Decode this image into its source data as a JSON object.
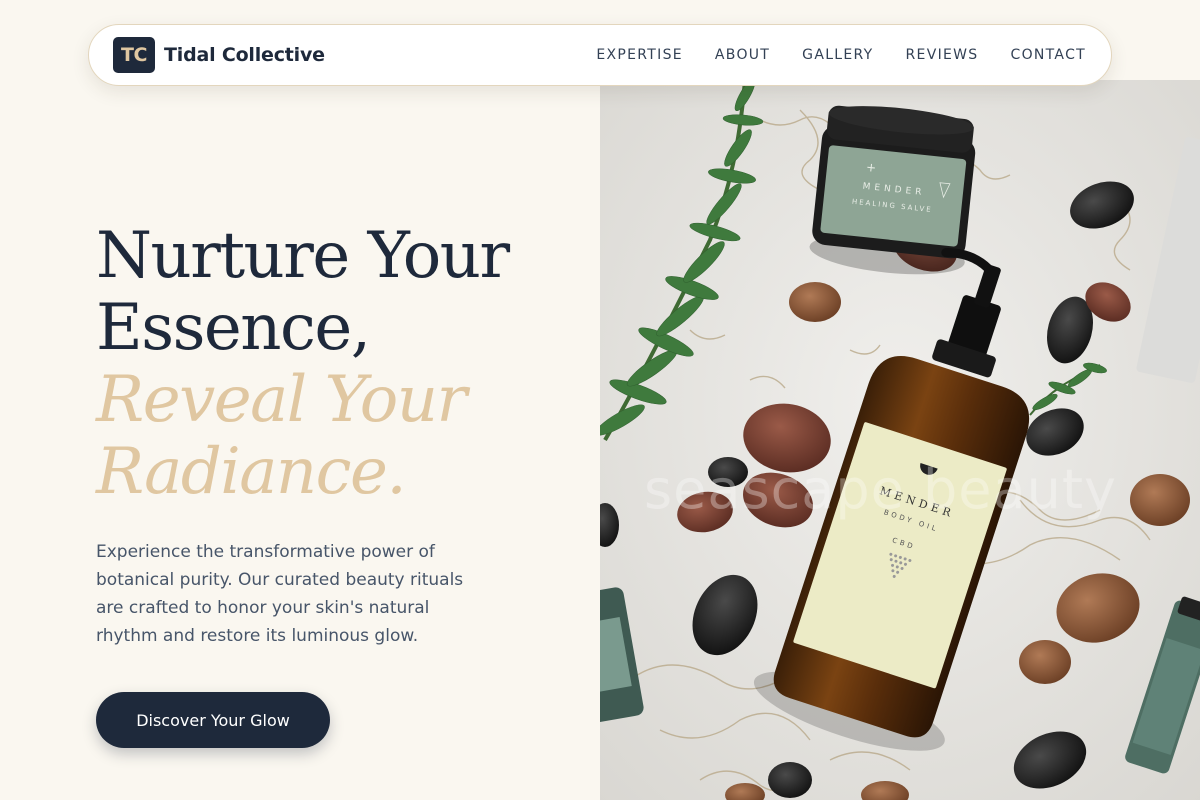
{
  "brand": {
    "logo_initials": "TC",
    "name": "Tidal Collective"
  },
  "nav": {
    "items": [
      "EXPERTISE",
      "ABOUT",
      "GALLERY",
      "REVIEWS",
      "CONTACT"
    ]
  },
  "hero": {
    "headline_line1": "Nurture Your",
    "headline_line2": "Essence,",
    "accent_line1": "Reveal Your",
    "accent_line2": "Radiance.",
    "description": "Experience the transformative power of botanical purity. Our curated beauty rituals are crafted to honor your skin's natural rhythm and restore its luminous glow.",
    "cta_label": "Discover Your Glow"
  },
  "image": {
    "watermark": "seascape beauty",
    "jar_brand": "MENDER",
    "jar_product": "HEALING SALVE",
    "bottle_brand": "MENDER",
    "bottle_product": "BODY OIL",
    "bottle_tag": "CBD"
  },
  "colors": {
    "background": "#faf7f0",
    "navy": "#1e293b",
    "accent_gold": "#e0c7a1",
    "body_text": "#475569"
  }
}
